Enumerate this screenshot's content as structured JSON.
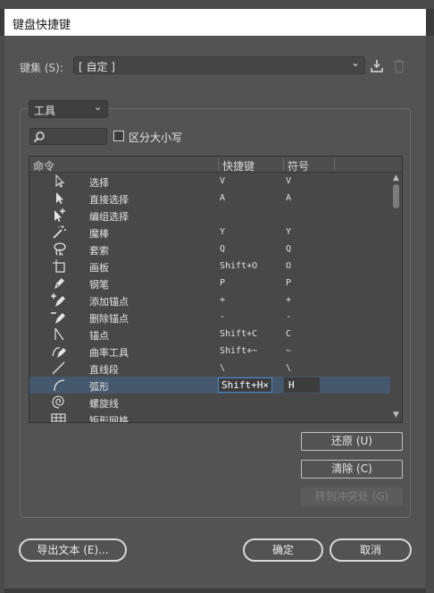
{
  "window": {
    "title": "键盘快捷键"
  },
  "keyset": {
    "label": "键集 (S):",
    "value": "[ 自定 ]"
  },
  "area": {
    "value": "工具"
  },
  "search": {
    "placeholder": "",
    "value": ""
  },
  "case_option": {
    "label": "区分大小写",
    "checked": false
  },
  "table": {
    "columns": [
      "命令",
      "快捷键",
      "符号"
    ],
    "rows": [
      {
        "icon": "selection-arrow-icon",
        "command": "选择",
        "shortcut": "V",
        "symbol": "V"
      },
      {
        "icon": "direct-selection-arrow-icon",
        "command": "直接选择",
        "shortcut": "A",
        "symbol": "A"
      },
      {
        "icon": "group-selection-arrow-icon",
        "command": "编组选择",
        "shortcut": "",
        "symbol": ""
      },
      {
        "icon": "magic-wand-icon",
        "command": "魔棒",
        "shortcut": "Y",
        "symbol": "Y"
      },
      {
        "icon": "lasso-icon",
        "command": "套索",
        "shortcut": "Q",
        "symbol": "Q"
      },
      {
        "icon": "artboard-icon",
        "command": "画板",
        "shortcut": "Shift+O",
        "symbol": "O"
      },
      {
        "icon": "pen-icon",
        "command": "钢笔",
        "shortcut": "P",
        "symbol": "P"
      },
      {
        "icon": "add-anchor-point-icon",
        "command": "添加锚点",
        "shortcut": "+",
        "symbol": "+"
      },
      {
        "icon": "delete-anchor-point-icon",
        "command": "删除锚点",
        "shortcut": "-",
        "symbol": "-"
      },
      {
        "icon": "anchor-point-icon",
        "command": "锚点",
        "shortcut": "Shift+C",
        "symbol": "C"
      },
      {
        "icon": "curvature-icon",
        "command": "曲率工具",
        "shortcut": "Shift+~",
        "symbol": "~"
      },
      {
        "icon": "line-segment-icon",
        "command": "直线段",
        "shortcut": "\\",
        "symbol": "\\"
      },
      {
        "icon": "arc-icon",
        "command": "弧形",
        "shortcut": "Shift+H",
        "symbol": "H",
        "selected": true
      },
      {
        "icon": "spiral-icon",
        "command": "螺旋线",
        "shortcut": "",
        "symbol": ""
      },
      {
        "icon": "rectangular-grid-icon",
        "command": "矩形网格",
        "shortcut": "",
        "symbol": ""
      }
    ]
  },
  "buttons": {
    "undo": "还原 (U)",
    "clear": "清除 (C)",
    "goto_conflict": "转到冲突处 (G)",
    "export_text": "导出文本 (E)...",
    "ok": "确定",
    "cancel": "取消"
  },
  "icons": {
    "save": "save-icon",
    "trash": "trash-icon",
    "search": "search-icon",
    "clear_field": "clear-x-icon"
  },
  "colors": {
    "selection": "#46586e",
    "focus_border": "#4d86c8",
    "dialog_bg": "#535353"
  }
}
